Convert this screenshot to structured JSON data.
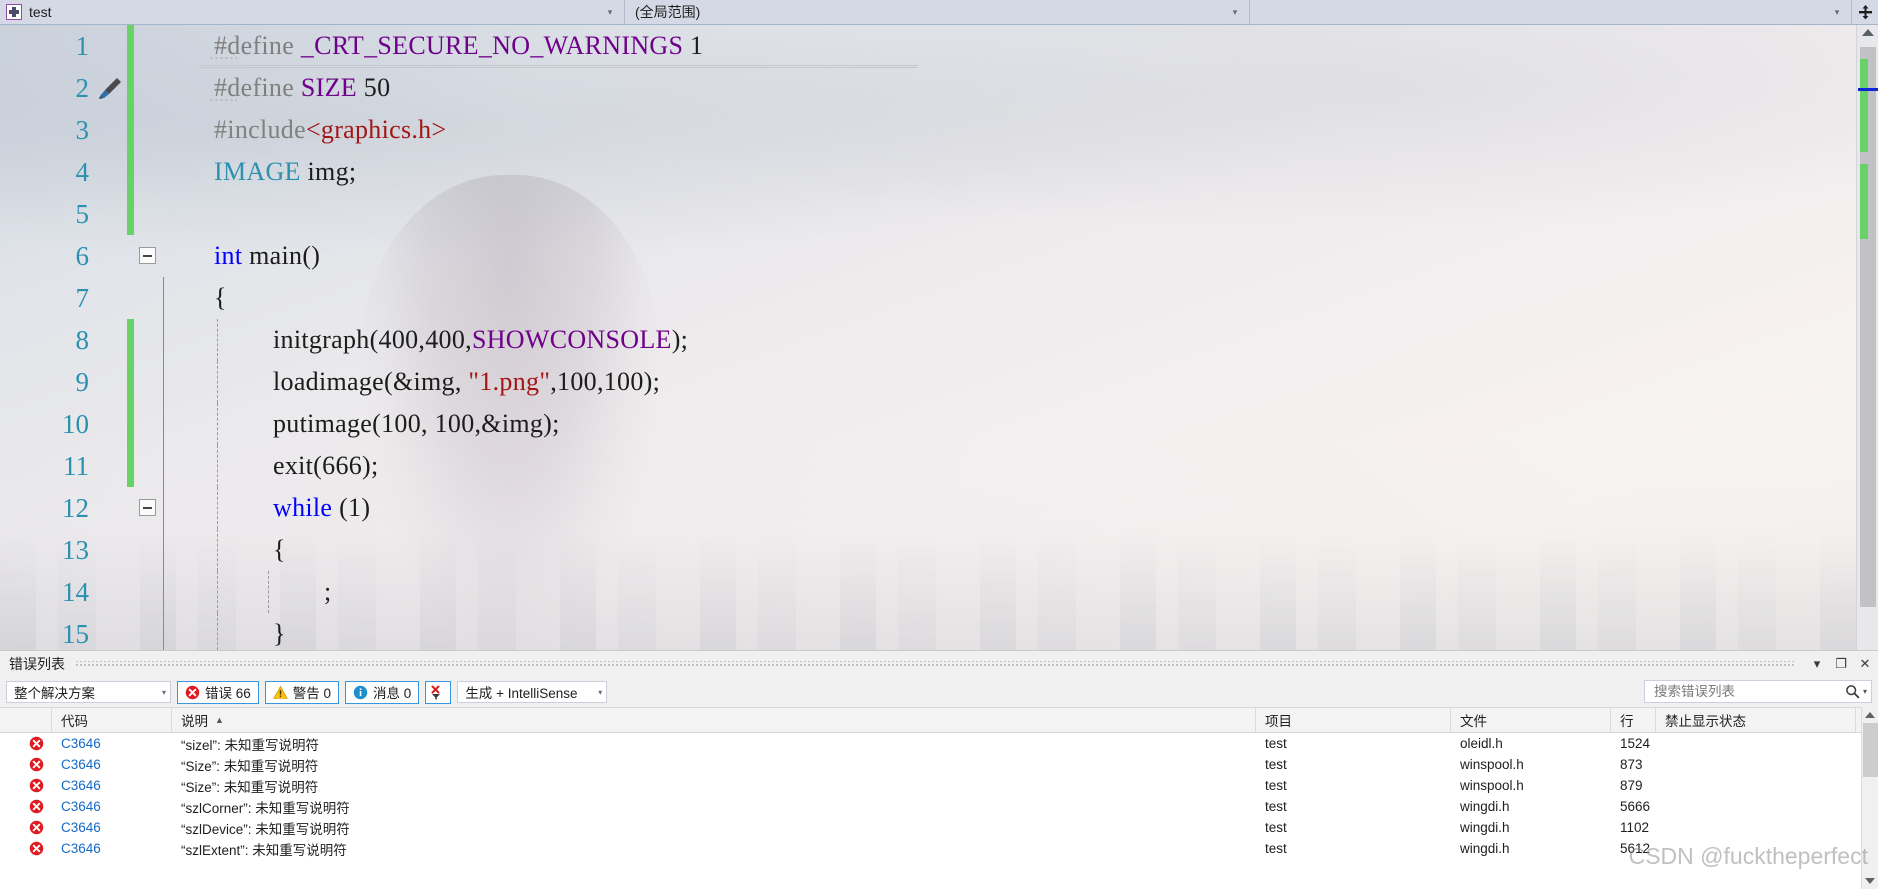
{
  "topbar": {
    "project_selector": "test",
    "scope_selector": "(全局范围)",
    "member_selector": "",
    "split_icon": "split-view-icon",
    "dropdown_arrow": "▾"
  },
  "editor": {
    "lines": [
      {
        "num": "1",
        "changed": true,
        "fold": "",
        "guide": "none",
        "indent": 0,
        "tokens": [
          {
            "t": "#define ",
            "c": "preproc"
          },
          {
            "t": "_CRT_SECURE_NO_WARNINGS ",
            "c": "macro"
          },
          {
            "t": "1",
            "c": "plain"
          }
        ]
      },
      {
        "num": "2",
        "changed": true,
        "fold": "",
        "guide": "none",
        "indent": 0,
        "tokens": [
          {
            "t": "#define ",
            "c": "preproc"
          },
          {
            "t": "SIZE ",
            "c": "macro"
          },
          {
            "t": "50",
            "c": "plain"
          }
        ]
      },
      {
        "num": "3",
        "changed": true,
        "fold": "",
        "guide": "none",
        "indent": 0,
        "tokens": [
          {
            "t": "#include",
            "c": "preproc"
          },
          {
            "t": "<graphics.h>",
            "c": "str"
          }
        ]
      },
      {
        "num": "4",
        "changed": true,
        "fold": "",
        "guide": "none",
        "indent": 0,
        "tokens": [
          {
            "t": "IMAGE",
            "c": "kw-teal"
          },
          {
            "t": " img;",
            "c": "plain"
          }
        ]
      },
      {
        "num": "5",
        "changed": true,
        "fold": "",
        "guide": "none",
        "indent": 0,
        "tokens": []
      },
      {
        "num": "6",
        "changed": false,
        "fold": "minus",
        "guide": "none",
        "indent": 0,
        "tokens": [
          {
            "t": "int",
            "c": "kw-blue"
          },
          {
            "t": " main()",
            "c": "plain"
          }
        ]
      },
      {
        "num": "7",
        "changed": false,
        "fold": "",
        "guide": "solid",
        "indent": 0,
        "tokens": [
          {
            "t": "{",
            "c": "plain"
          }
        ]
      },
      {
        "num": "8",
        "changed": true,
        "fold": "",
        "guide": "solid",
        "indent": 1,
        "tokens": [
          {
            "t": "initgraph(400,400,",
            "c": "plain"
          },
          {
            "t": "SHOWCONSOLE",
            "c": "macro"
          },
          {
            "t": ");",
            "c": "plain"
          }
        ]
      },
      {
        "num": "9",
        "changed": true,
        "fold": "",
        "guide": "solid",
        "indent": 1,
        "tokens": [
          {
            "t": "loadimage(&img, ",
            "c": "plain"
          },
          {
            "t": "\"1.png\"",
            "c": "str"
          },
          {
            "t": ",100,100);",
            "c": "plain"
          }
        ]
      },
      {
        "num": "10",
        "changed": true,
        "fold": "",
        "guide": "solid",
        "indent": 1,
        "tokens": [
          {
            "t": "putimage(100, 100,&img);",
            "c": "plain"
          }
        ]
      },
      {
        "num": "11",
        "changed": true,
        "fold": "",
        "guide": "solid",
        "indent": 1,
        "tokens": [
          {
            "t": "exit(666);",
            "c": "plain"
          }
        ]
      },
      {
        "num": "12",
        "changed": false,
        "fold": "minus",
        "guide": "solid",
        "indent": 1,
        "tokens": [
          {
            "t": "while",
            "c": "kw-blue"
          },
          {
            "t": " (1)",
            "c": "plain"
          }
        ]
      },
      {
        "num": "13",
        "changed": false,
        "fold": "",
        "guide": "solid",
        "indent": 1,
        "tokens": [
          {
            "t": "{",
            "c": "plain"
          }
        ]
      },
      {
        "num": "14",
        "changed": false,
        "fold": "",
        "guide": "solid",
        "indent": 2,
        "tokens": [
          {
            "t": ";",
            "c": "plain"
          }
        ]
      },
      {
        "num": "15",
        "changed": false,
        "fold": "",
        "guide": "solid",
        "indent": 1,
        "tokens": [
          {
            "t": "}",
            "c": "plain"
          }
        ]
      }
    ],
    "gutter_icon_line": "2",
    "gutter_icon_name": "quick-actions-brush-icon"
  },
  "error_panel": {
    "title": "错误列表",
    "window_buttons": {
      "dropdown": "▾",
      "float": "❐",
      "close": "✕"
    },
    "scope_filter": "整个解决方案",
    "errors_label": "错误 66",
    "warnings_label": "警告 0",
    "messages_label": "消息 0",
    "clear_filter_icon": "clear-filter-icon",
    "build_filter": "生成 + IntelliSense",
    "search_placeholder": "搜索错误列表",
    "search_value": "",
    "columns": [
      "",
      "代码",
      "说明",
      "项目",
      "文件",
      "行",
      "禁止显示状态"
    ],
    "sorted_column": "说明",
    "sort_arrow": "▲",
    "rows": [
      {
        "severity": "error",
        "code": "C3646",
        "description": "“sizel”: 未知重写说明符",
        "project": "test",
        "file": "oleidl.h",
        "line": "1524",
        "suppression": ""
      },
      {
        "severity": "error",
        "code": "C3646",
        "description": "“Size”: 未知重写说明符",
        "project": "test",
        "file": "winspool.h",
        "line": "873",
        "suppression": ""
      },
      {
        "severity": "error",
        "code": "C3646",
        "description": "“Size”: 未知重写说明符",
        "project": "test",
        "file": "winspool.h",
        "line": "879",
        "suppression": ""
      },
      {
        "severity": "error",
        "code": "C3646",
        "description": "“szlCorner”: 未知重写说明符",
        "project": "test",
        "file": "wingdi.h",
        "line": "5666",
        "suppression": ""
      },
      {
        "severity": "error",
        "code": "C3646",
        "description": "“szlDevice”: 未知重写说明符",
        "project": "test",
        "file": "wingdi.h",
        "line": "1102",
        "suppression": ""
      },
      {
        "severity": "error",
        "code": "C3646",
        "description": "“szlExtent”: 未知重写说明符",
        "project": "test",
        "file": "wingdi.h",
        "line": "5612",
        "suppression": ""
      }
    ]
  },
  "watermark": "CSDN @fucktheperfect",
  "colors": {
    "accent_blue": "#3d99d8",
    "error_red": "#e01b24",
    "warning_yellow": "#ffc20e",
    "info_blue": "#1e90d0",
    "change_green": "#68d168",
    "keyword_blue": "#0000ff",
    "type_teal": "#2b91af",
    "macro_purple": "#6f008a",
    "string_red": "#a31515",
    "linenum_teal": "#2b91af"
  }
}
